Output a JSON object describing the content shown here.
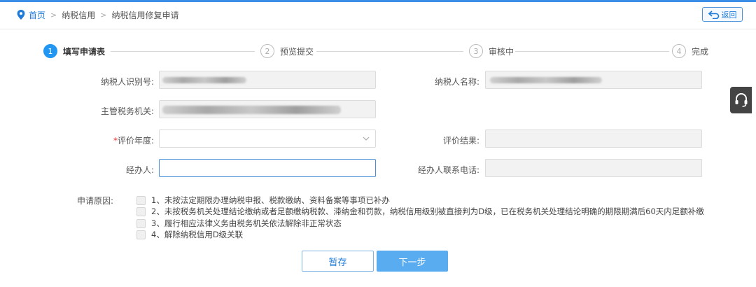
{
  "breadcrumb": {
    "home": "首页",
    "level2": "纳税信用",
    "level3": "纳税信用修复申请",
    "separator": ">"
  },
  "header": {
    "back_label": "返回"
  },
  "steps": [
    {
      "num": "1",
      "label": "填写申请表"
    },
    {
      "num": "2",
      "label": "预览提交"
    },
    {
      "num": "3",
      "label": "审核中"
    },
    {
      "num": "4",
      "label": "完成"
    }
  ],
  "form": {
    "taxpayer_id_label": "纳税人识别号:",
    "taxpayer_name_label": "纳税人名称:",
    "tax_authority_label": "主管税务机关:",
    "eval_year_required_mark": "*",
    "eval_year_label": "评价年度:",
    "eval_result_label": "评价结果:",
    "handler_label": "经办人:",
    "handler_phone_label": "经办人联系电话:"
  },
  "reasons": {
    "label": "申请原因:",
    "items": [
      "1、未按法定期限办理纳税申报、税款缴纳、资料备案等事项已补办",
      "2、未按税务机关处理结论缴纳或者足额缴纳税款、滞纳金和罚款，纳税信用级别被直接判为D级，已在税务机关处理结论明确的期限期满后60天内足额补缴",
      "3、履行相应法律义务由税务机关依法解除非正常状态",
      "4、解除纳税信用D级关联"
    ]
  },
  "actions": {
    "save_label": "暂存",
    "next_label": "下一步"
  },
  "icons": {
    "location": "location-pin-icon",
    "back": "return-arrow-icon",
    "dropdown": "chevron-down-icon",
    "help": "headset-icon"
  },
  "colors": {
    "accent": "#2196f3",
    "primary_button": "#5aacf0",
    "link": "#1e7bd8",
    "required": "#e53935"
  }
}
